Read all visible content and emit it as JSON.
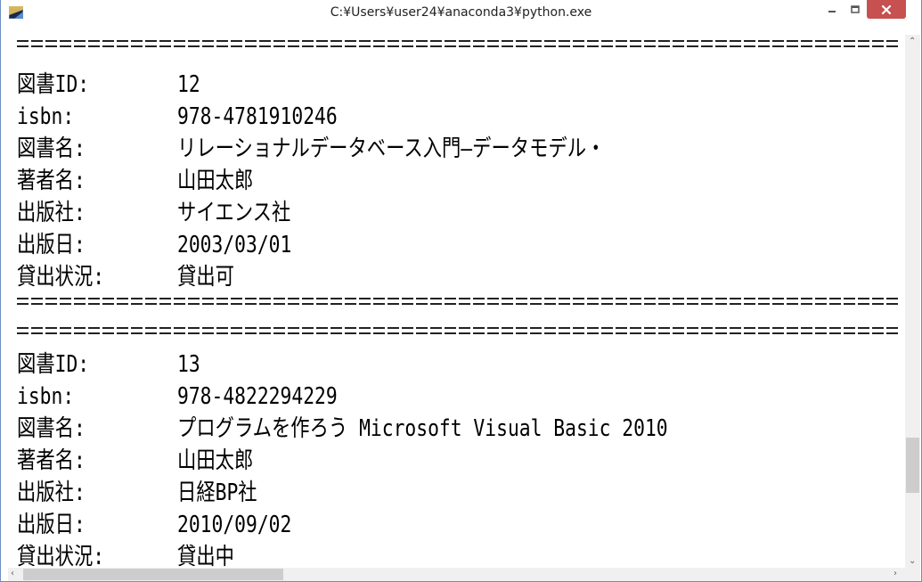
{
  "window": {
    "title": "C:¥Users¥user24¥anaconda3¥python.exe",
    "icons": {
      "app": "console-app-icon",
      "minimize": "minimize-icon",
      "maximize": "maximize-icon",
      "close": "close-icon"
    },
    "colors": {
      "close_button": "#c75050",
      "frame": "#6d8fc2"
    }
  },
  "records": [
    {
      "fields": [
        {
          "label": "図書ID:",
          "value": "12"
        },
        {
          "label": "isbn:",
          "value": "978-4781910246"
        },
        {
          "label": "図書名:",
          "value": "リレーショナルデータベース入門―データモデル・"
        },
        {
          "label": "著者名:",
          "value": "山田太郎"
        },
        {
          "label": "出版社:",
          "value": "サイエンス社"
        },
        {
          "label": "出版日:",
          "value": "2003/03/01"
        },
        {
          "label": "貸出状況:",
          "value": "貸出可"
        }
      ]
    },
    {
      "fields": [
        {
          "label": "図書ID:",
          "value": "13"
        },
        {
          "label": "isbn:",
          "value": "978-4822294229"
        },
        {
          "label": "図書名:",
          "value": "プログラムを作ろう Microsoft Visual Basic 2010"
        },
        {
          "label": "著者名:",
          "value": "山田太郎"
        },
        {
          "label": "出版社:",
          "value": "日経BP社"
        },
        {
          "label": "出版日:",
          "value": "2010/09/02"
        },
        {
          "label": "貸出状況:",
          "value": "貸出中"
        }
      ]
    }
  ],
  "scrollbars": {
    "icons": {
      "up": "scroll-up-arrow-icon",
      "down": "scroll-down-arrow-icon",
      "left": "scroll-left-arrow-icon",
      "right": "scroll-right-arrow-icon"
    }
  }
}
